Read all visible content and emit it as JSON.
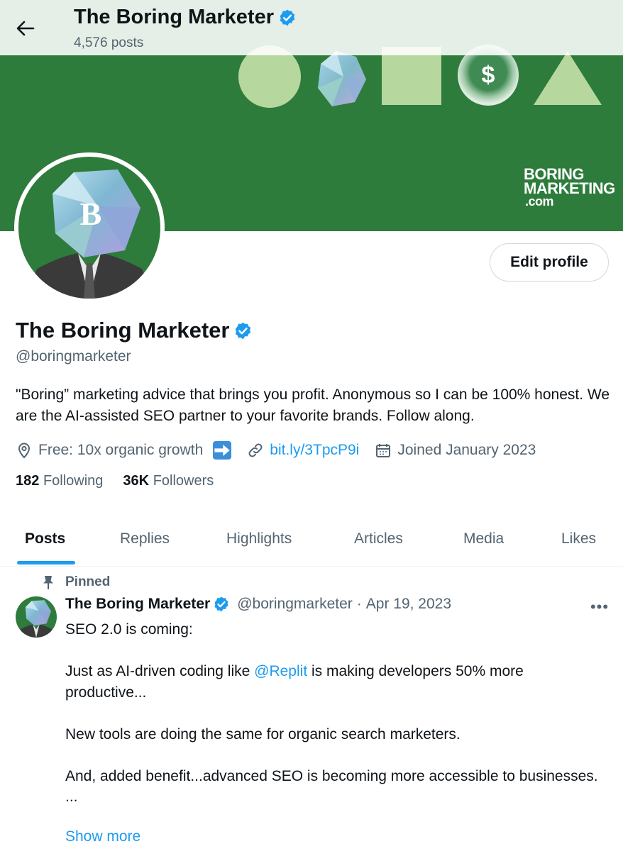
{
  "header": {
    "title": "The Boring Marketer",
    "post_count": "4,576 posts"
  },
  "banner": {
    "coin_symbol": "$",
    "brand_line1": "BORING",
    "brand_line2": "MARKETING",
    "brand_line3": ".com"
  },
  "avatar": {
    "letter": "B"
  },
  "profile": {
    "edit_label": "Edit profile",
    "name": "The Boring Marketer",
    "handle": "@boringmarketer",
    "bio": "\"Boring” marketing advice that brings you profit. Anonymous so I can be 100% honest. We are the AI-assisted SEO partner to your favorite brands. Follow along.",
    "location": "Free: 10x organic growth",
    "website": "bit.ly/3TpcP9i",
    "joined": "Joined January 2023",
    "following_count": "182",
    "following_label": "Following",
    "followers_count": "36K",
    "followers_label": "Followers"
  },
  "tabs": [
    {
      "label": "Posts",
      "active": true
    },
    {
      "label": "Replies",
      "active": false
    },
    {
      "label": "Highlights",
      "active": false
    },
    {
      "label": "Articles",
      "active": false
    },
    {
      "label": "Media",
      "active": false
    },
    {
      "label": "Likes",
      "active": false
    }
  ],
  "tweet": {
    "pinned_label": "Pinned",
    "author_name": "The Boring Marketer",
    "author_handle": "@boringmarketer",
    "separator": "·",
    "date": "Apr 19, 2023",
    "more": "•••",
    "line1": "SEO 2.0 is coming:",
    "line2_pre": "Just as AI-driven coding like ",
    "line2_mention": "@Replit",
    "line2_post": " is making developers 50% more productive...",
    "line3": "New tools are doing the same for organic search marketers.",
    "line4": "And, added benefit...advanced SEO is becoming more accessible to businesses.",
    "line5": "...",
    "show_more": "Show more"
  },
  "colors": {
    "banner_green": "#2e7c3c",
    "shape_green": "#b6d79e",
    "accent_blue": "#1d9bf0",
    "muted_text": "#536471"
  },
  "icons": [
    "back-arrow-icon",
    "verified-badge-icon",
    "location-pin-icon",
    "arrow-right-emoji-icon",
    "link-icon",
    "calendar-icon",
    "pin-icon",
    "more-options-icon"
  ]
}
